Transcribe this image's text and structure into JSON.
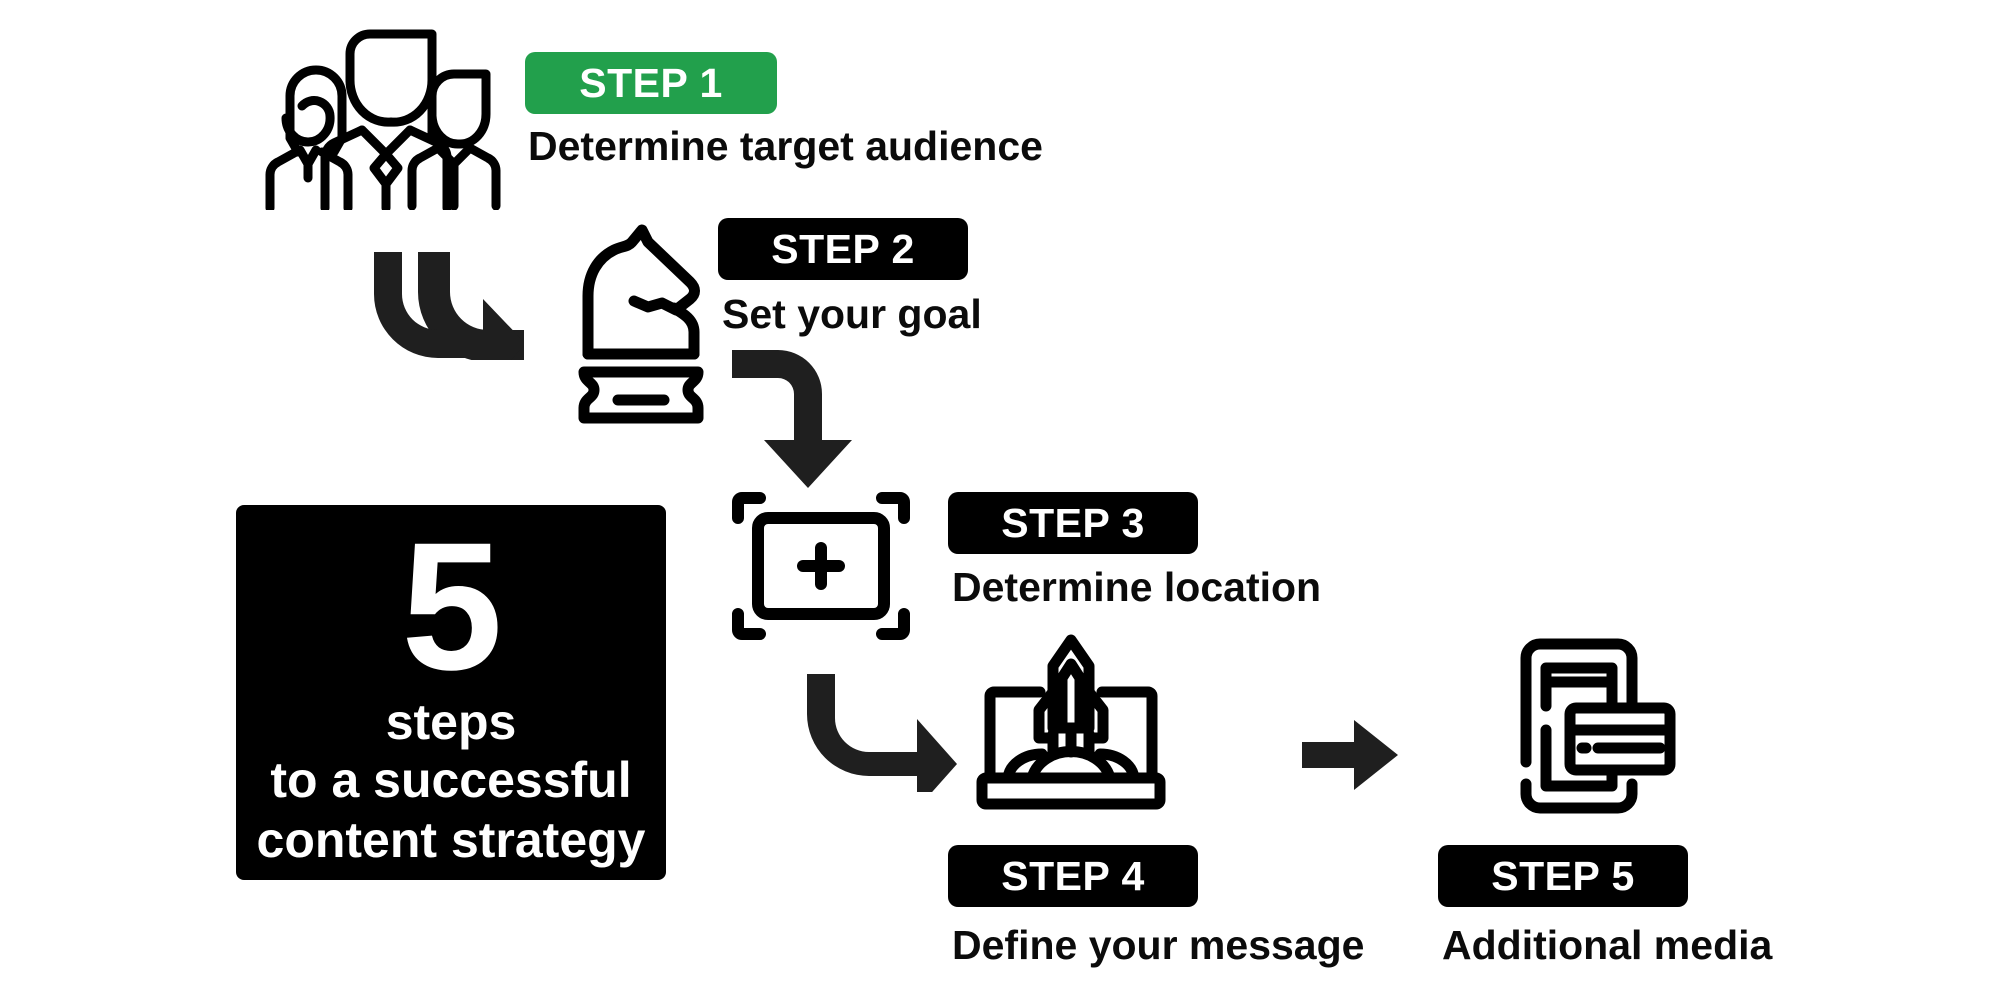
{
  "page": {
    "background": "#ffffff",
    "accent_green": "#22A04C",
    "dark": "#000000"
  },
  "panel": {
    "number": "5",
    "lead": "steps",
    "line2": "to a successful",
    "line3": "content strategy"
  },
  "steps": [
    {
      "badge": "STEP 1",
      "badge_color": "#22A04C",
      "caption": "Determine target audience",
      "icon": "group-of-people-icon"
    },
    {
      "badge": "STEP 2",
      "badge_color": "#000000",
      "caption": "Set your goal",
      "icon": "chess-knight-icon"
    },
    {
      "badge": "STEP 3",
      "badge_color": "#000000",
      "caption": "Determine location",
      "icon": "crosshair-frame-icon"
    },
    {
      "badge": "STEP 4",
      "badge_color": "#000000",
      "caption": "Define your message",
      "icon": "rocket-launch-laptop-icon"
    },
    {
      "badge": "STEP 5",
      "badge_color": "#000000",
      "caption": "Additional media",
      "icon": "tablet-and-card-icon"
    }
  ],
  "connectors": [
    {
      "name": "arrow-step1-to-step2",
      "shape": "elbow-down-right"
    },
    {
      "name": "arrow-step2-to-step3",
      "shape": "elbow-right-down"
    },
    {
      "name": "arrow-step3-to-step4",
      "shape": "elbow-down-right"
    },
    {
      "name": "arrow-step4-to-step5",
      "shape": "straight-right"
    }
  ]
}
